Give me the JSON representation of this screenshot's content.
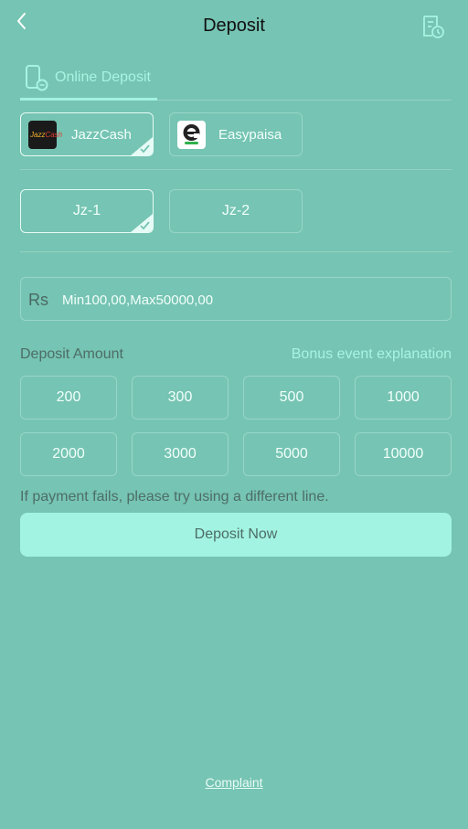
{
  "header": {
    "title": "Deposit",
    "back_icon": "chevron-left-icon",
    "history_icon": "document-clock-icon"
  },
  "tabs": [
    {
      "label": "Online Deposit",
      "icon": "mobile-payment-icon",
      "active": true
    }
  ],
  "payment_methods": [
    {
      "label": "JazzCash",
      "logo_text": "JazzCash",
      "logo_color": "#1a1a1a",
      "selected": true
    },
    {
      "label": "Easypaisa",
      "logo_text": "e",
      "logo_color": "#ffffff",
      "selected": false
    }
  ],
  "lines": [
    {
      "label": "Jz-1",
      "selected": true
    },
    {
      "label": "Jz-2",
      "selected": false
    }
  ],
  "amount_input": {
    "currency": "Rs",
    "placeholder": "Min100,00,Max50000,00"
  },
  "amounts_section": {
    "label": "Deposit Amount",
    "bonus_link": "Bonus event explanation"
  },
  "amounts": [
    "200",
    "300",
    "500",
    "1000",
    "2000",
    "3000",
    "5000",
    "10000"
  ],
  "hint": "If payment fails, please try using a different line.",
  "submit_label": "Deposit Now",
  "complaint_label": "Complaint",
  "colors": {
    "background": "#76c4b3",
    "accent": "#a3f3e2",
    "selected_border": "#e6fbf6"
  }
}
